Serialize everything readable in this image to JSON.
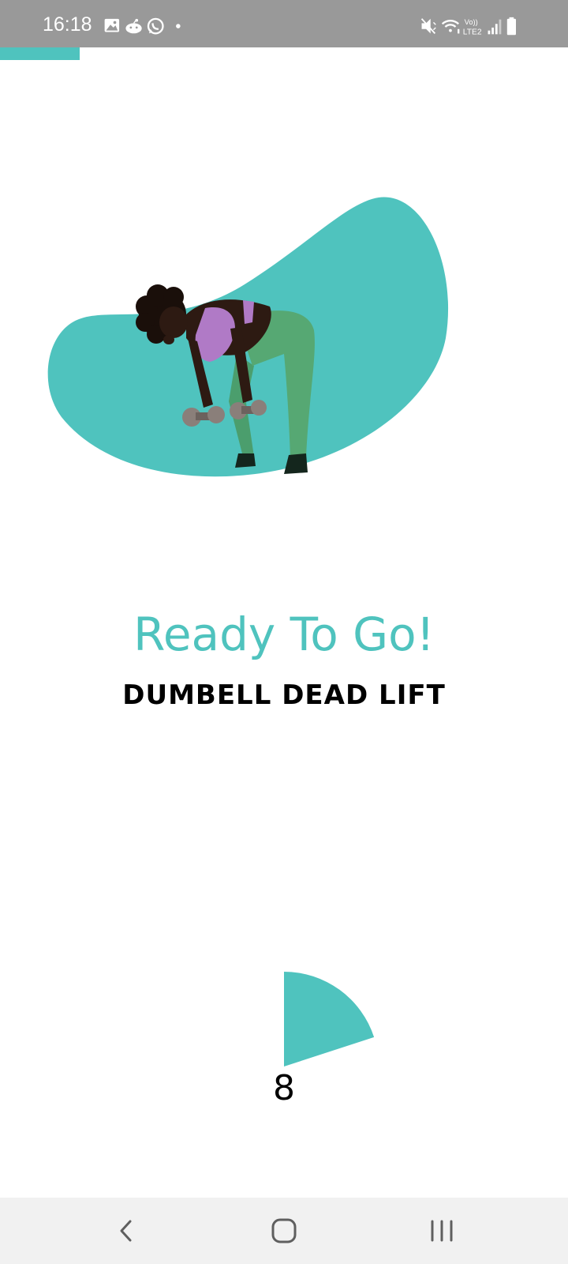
{
  "status_bar": {
    "time": "16:18",
    "left_icons": [
      "gallery-icon",
      "reddit-icon",
      "whatsapp-icon",
      "dot-icon"
    ],
    "right_icons": [
      "mute-icon",
      "wifi-icon",
      "volte-lte2-icon",
      "signal-icon",
      "battery-icon"
    ],
    "network_label": "Vo)) LTE2"
  },
  "workout_progress": 0.14,
  "main": {
    "headline": "Ready To Go!",
    "exercise_name": "DUMBELL DEAD LIFT",
    "illustration": "woman-dumbbell-deadlift-illustration"
  },
  "countdown": {
    "value": "8",
    "fraction_elapsed": 0.2
  },
  "nav_bar": {
    "buttons": [
      "back-icon",
      "home-icon",
      "recents-icon"
    ]
  },
  "colors": {
    "accent": "#4fc3be",
    "status_bar": "#999999",
    "nav_bar": "#f1f1f1",
    "text": "#000000"
  }
}
